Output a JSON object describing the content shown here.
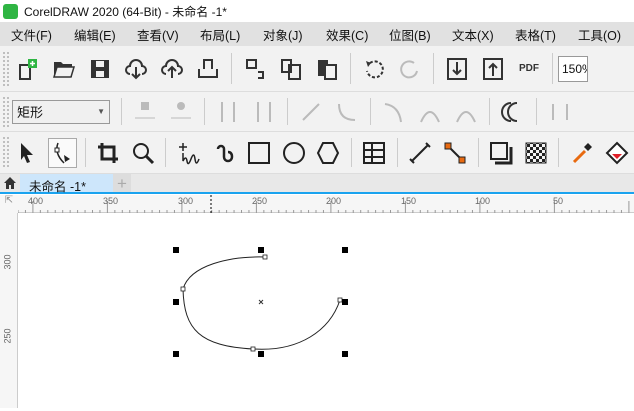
{
  "window": {
    "title": "CorelDRAW 2020 (64-Bit) - 未命名 -1*"
  },
  "menu": [
    "文件(F)",
    "编辑(E)",
    "查看(V)",
    "布局(L)",
    "对象(J)",
    "效果(C)",
    "位图(B)",
    "文本(X)",
    "表格(T)",
    "工具(O)"
  ],
  "toolbar": {
    "zoom_value": "150%",
    "pdf_label": "PDF"
  },
  "property_bar": {
    "object_type": "矩形"
  },
  "tabs": {
    "document": "未命名 -1*",
    "add": "+"
  },
  "ruler": {
    "horizontal": [
      "400",
      "350",
      "300",
      "250",
      "200",
      "150",
      "100",
      "50"
    ],
    "vertical": [
      "300",
      "250"
    ]
  },
  "colors": {
    "accent": "#1aa3ef",
    "logo": "#2fb543",
    "handle": "#000000",
    "outline_accent": "#e86a10"
  }
}
